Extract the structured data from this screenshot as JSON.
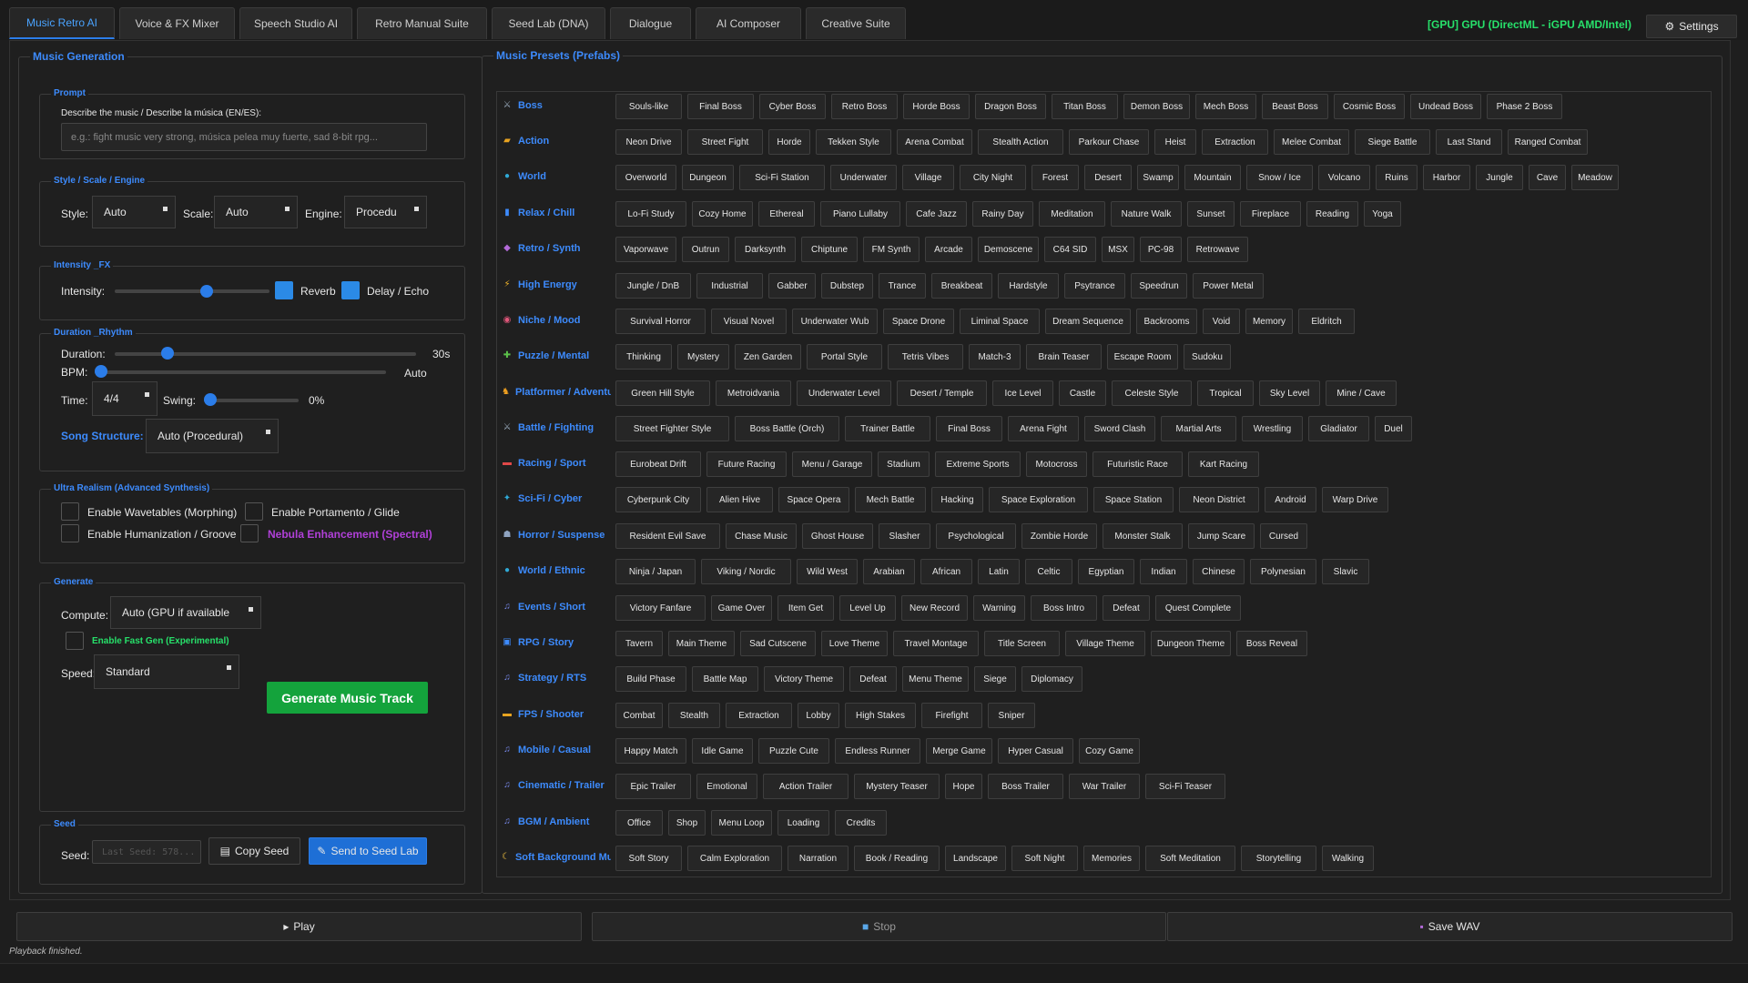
{
  "tabs": [
    "Music Retro AI",
    "Voice & FX Mixer",
    "Speech Studio AI",
    "Retro Manual Suite",
    "Seed Lab (DNA)",
    "Dialogue",
    "AI Composer",
    "Creative Suite"
  ],
  "gpu_status": "[GPU] GPU (DirectML - iGPU AMD/Intel)",
  "settings_label": "Settings",
  "music_generation": {
    "title": "Music Generation",
    "prompt": {
      "section": "Prompt",
      "label": "Describe the music / Describe la música (EN/ES):",
      "placeholder": "e.g.: fight music very strong, música pelea muy fuerte, sad 8-bit rpg..."
    },
    "style": {
      "section": "Style / Scale / Engine",
      "style_label": "Style:",
      "style_value": "Auto",
      "scale_label": "Scale:",
      "scale_value": "Auto",
      "engine_label": "Engine:",
      "engine_value": "Procedu"
    },
    "intensity": {
      "section": "Intensity _FX",
      "label": "Intensity:",
      "value": 0.6,
      "reverb": "Reverb",
      "reverb_on": true,
      "delay": "Delay / Echo",
      "delay_on": true
    },
    "duration": {
      "section": "Duration _Rhythm",
      "duration_label": "Duration:",
      "duration_value": "30s",
      "duration_pos": 0.16,
      "bpm_label": "BPM:",
      "bpm_value": "Auto",
      "bpm_pos": 0.0,
      "time_label": "Time:",
      "time_value": "4/4",
      "swing_label": "Swing:",
      "swing_value": "0%",
      "swing_pos": 0.0,
      "structure_label": "Song Structure:",
      "structure_value": "Auto (Procedural)"
    },
    "ultra": {
      "section": "Ultra Realism (Advanced Synthesis)",
      "wavetables": "Enable Wavetables (Morphing)",
      "portamento": "Enable Portamento / Glide",
      "humanization": "Enable Humanization / Groove",
      "nebula": "Nebula Enhancement (Spectral)"
    },
    "generate": {
      "section": "Generate",
      "compute_label": "Compute:",
      "compute_value": "Auto (GPU if available",
      "fastgen": "Enable Fast Gen (Experimental)",
      "speed_label": "Speed:",
      "speed_value": "Standard",
      "button": "Generate Music Track"
    },
    "seed": {
      "section": "Seed",
      "label": "Seed:",
      "placeholder": "Last Seed: 578...",
      "copy": "Copy Seed",
      "send": "Send to Seed Lab"
    }
  },
  "presets": {
    "title": "Music Presets (Prefabs)",
    "rows": [
      {
        "label": "Boss",
        "icon": "crossed-swords-icon",
        "glyph": "⚔",
        "color": "#9ab",
        "items": [
          "Souls-like",
          "Final Boss",
          "Cyber Boss",
          "Retro Boss",
          "Horde Boss",
          "Dragon Boss",
          "Titan Boss",
          "Demon Boss",
          "Mech Boss",
          "Beast Boss",
          "Cosmic Boss",
          "Undead Boss",
          "Phase 2 Boss"
        ]
      },
      {
        "label": "Action",
        "icon": "folder-icon",
        "glyph": "▰",
        "color": "#e8a320",
        "items": [
          "Neon Drive",
          "Street Fight",
          "Horde",
          "Tekken Style",
          "Arena Combat",
          "Stealth Action",
          "Parkour Chase",
          "Heist",
          "Extraction",
          "Melee Combat",
          "Siege Battle",
          "Last Stand",
          "Ranged Combat"
        ]
      },
      {
        "label": "World",
        "icon": "globe-icon",
        "glyph": "●",
        "color": "#2fa9d6",
        "items": [
          "Overworld",
          "Dungeon",
          "Sci-Fi Station",
          "Underwater",
          "Village",
          "City Night",
          "Forest",
          "Desert",
          "Swamp",
          "Mountain",
          "Snow / Ice",
          "Volcano",
          "Ruins",
          "Harbor",
          "Jungle",
          "Cave",
          "Meadow"
        ]
      },
      {
        "label": "Relax / Chill",
        "icon": "chart-icon",
        "glyph": "▮",
        "color": "#3d8bfd",
        "items": [
          "Lo-Fi Study",
          "Cozy Home",
          "Ethereal",
          "Piano Lullaby",
          "Cafe Jazz",
          "Rainy Day",
          "Meditation",
          "Nature Walk",
          "Sunset",
          "Fireplace",
          "Reading",
          "Yoga"
        ]
      },
      {
        "label": "Retro / Synth",
        "icon": "synth-icon",
        "glyph": "◆",
        "color": "#b36ad8",
        "items": [
          "Vaporwave",
          "Outrun",
          "Darksynth",
          "Chiptune",
          "FM Synth",
          "Arcade",
          "Demoscene",
          "C64 SID",
          "MSX",
          "PC-98",
          "Retrowave"
        ]
      },
      {
        "label": "High Energy",
        "icon": "lightning-icon",
        "glyph": "⚡",
        "color": "#f0b429",
        "items": [
          "Jungle / DnB",
          "Industrial",
          "Gabber",
          "Dubstep",
          "Trance",
          "Breakbeat",
          "Hardstyle",
          "Psytrance",
          "Speedrun",
          "Power Metal"
        ]
      },
      {
        "label": "Niche / Mood",
        "icon": "mask-icon",
        "glyph": "◉",
        "color": "#e0567a",
        "items": [
          "Survival Horror",
          "Visual Novel",
          "Underwater Wub",
          "Space Drone",
          "Liminal Space",
          "Dream Sequence",
          "Backrooms",
          "Void",
          "Memory",
          "Eldritch"
        ]
      },
      {
        "label": "Puzzle / Mental",
        "icon": "puzzle-icon",
        "glyph": "✚",
        "color": "#5cc24a",
        "items": [
          "Thinking",
          "Mystery",
          "Zen Garden",
          "Portal Style",
          "Tetris Vibes",
          "Match-3",
          "Brain Teaser",
          "Escape Room",
          "Sudoku"
        ]
      },
      {
        "label": "Platformer / Adventure",
        "icon": "runner-icon",
        "glyph": "♞",
        "color": "#f0a020",
        "items": [
          "Green Hill Style",
          "Metroidvania",
          "Underwater Level",
          "Desert / Temple",
          "Ice Level",
          "Castle",
          "Celeste Style",
          "Tropical",
          "Sky Level",
          "Mine / Cave"
        ]
      },
      {
        "label": "Battle / Fighting",
        "icon": "crossed-swords-icon",
        "glyph": "⚔",
        "color": "#9ab",
        "items": [
          "Street Fighter Style",
          "Boss Battle (Orch)",
          "Trainer Battle",
          "Final Boss",
          "Arena Fight",
          "Sword Clash",
          "Martial Arts",
          "Wrestling",
          "Gladiator",
          "Duel"
        ]
      },
      {
        "label": "Racing / Sport",
        "icon": "race-car-icon",
        "glyph": "▬",
        "color": "#e04848",
        "items": [
          "Eurobeat Drift",
          "Future Racing",
          "Menu / Garage",
          "Stadium",
          "Extreme Sports",
          "Motocross",
          "Futuristic Race",
          "Kart Racing"
        ]
      },
      {
        "label": "Sci-Fi / Cyber",
        "icon": "satellite-icon",
        "glyph": "✦",
        "color": "#2fa9d6",
        "items": [
          "Cyberpunk City",
          "Alien Hive",
          "Space Opera",
          "Mech Battle",
          "Hacking",
          "Space Exploration",
          "Space Station",
          "Neon District",
          "Android",
          "Warp Drive"
        ]
      },
      {
        "label": "Horror / Suspense",
        "icon": "skull-icon",
        "glyph": "☗",
        "color": "#8fa3c0",
        "items": [
          "Resident Evil Save",
          "Chase Music",
          "Ghost House",
          "Slasher",
          "Psychological",
          "Zombie Horde",
          "Monster Stalk",
          "Jump Scare",
          "Cursed"
        ]
      },
      {
        "label": "World / Ethnic",
        "icon": "globe-icon",
        "glyph": "●",
        "color": "#2fa9d6",
        "items": [
          "Ninja / Japan",
          "Viking / Nordic",
          "Wild West",
          "Arabian",
          "African",
          "Latin",
          "Celtic",
          "Egyptian",
          "Indian",
          "Chinese",
          "Polynesian",
          "Slavic"
        ]
      },
      {
        "label": "Events / Short",
        "icon": "music-note-icon",
        "glyph": "♫",
        "color": "#7a8cf0",
        "items": [
          "Victory Fanfare",
          "Game Over",
          "Item Get",
          "Level Up",
          "New Record",
          "Warning",
          "Boss Intro",
          "Defeat",
          "Quest Complete"
        ]
      },
      {
        "label": "RPG / Story",
        "icon": "book-icon",
        "glyph": "▣",
        "color": "#3d8bfd",
        "items": [
          "Tavern",
          "Main Theme",
          "Sad Cutscene",
          "Love Theme",
          "Travel Montage",
          "Title Screen",
          "Village Theme",
          "Dungeon Theme",
          "Boss Reveal"
        ]
      },
      {
        "label": "Strategy / RTS",
        "icon": "music-note-icon",
        "glyph": "♫",
        "color": "#7a8cf0",
        "items": [
          "Build Phase",
          "Battle Map",
          "Victory Theme",
          "Defeat",
          "Menu Theme",
          "Siege",
          "Diplomacy"
        ]
      },
      {
        "label": "FPS / Shooter",
        "icon": "gun-icon",
        "glyph": "▬",
        "color": "#e8a320",
        "items": [
          "Combat",
          "Stealth",
          "Extraction",
          "Lobby",
          "High Stakes",
          "Firefight",
          "Sniper"
        ]
      },
      {
        "label": "Mobile / Casual",
        "icon": "music-note-icon",
        "glyph": "♫",
        "color": "#7a8cf0",
        "items": [
          "Happy Match",
          "Idle Game",
          "Puzzle Cute",
          "Endless Runner",
          "Merge Game",
          "Hyper Casual",
          "Cozy Game"
        ]
      },
      {
        "label": "Cinematic / Trailer",
        "icon": "music-note-icon",
        "glyph": "♫",
        "color": "#7a8cf0",
        "items": [
          "Epic Trailer",
          "Emotional",
          "Action Trailer",
          "Mystery Teaser",
          "Hope",
          "Boss Trailer",
          "War Trailer",
          "Sci-Fi Teaser"
        ]
      },
      {
        "label": "BGM / Ambient",
        "icon": "music-note-icon",
        "glyph": "♫",
        "color": "#7a8cf0",
        "items": [
          "Office",
          "Shop",
          "Menu Loop",
          "Loading",
          "Credits"
        ]
      },
      {
        "label": "Soft Background Music",
        "icon": "moon-icon",
        "glyph": "☾",
        "color": "#f0c040",
        "items": [
          "Soft Story",
          "Calm Exploration",
          "Narration",
          "Book / Reading",
          "Landscape",
          "Soft Night",
          "Memories",
          "Soft Meditation",
          "Storytelling",
          "Walking"
        ]
      }
    ]
  },
  "controls": {
    "play": "Play",
    "stop": "Stop",
    "save": "Save WAV"
  },
  "status": "Playback finished."
}
